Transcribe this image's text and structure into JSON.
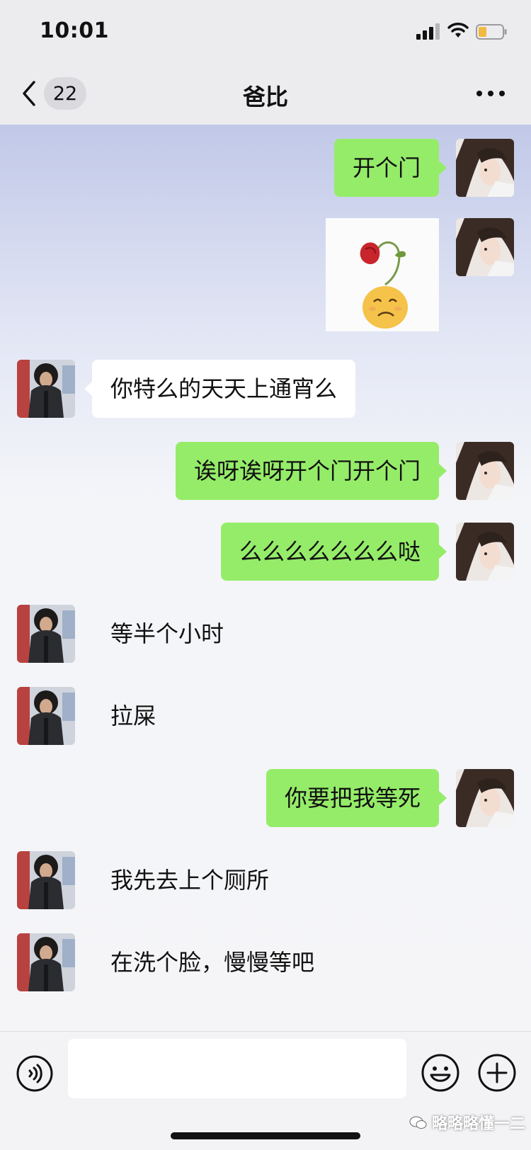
{
  "status_bar": {
    "time": "10:01"
  },
  "header": {
    "unread_count": "22",
    "title": "爸比"
  },
  "messages": [
    {
      "side": "right",
      "type": "text",
      "text": "开个门"
    },
    {
      "side": "right",
      "type": "sticker",
      "icon": "wilted-rose-sad-face-sticker"
    },
    {
      "side": "left",
      "type": "text",
      "text": "你特么的天天上通宵么"
    },
    {
      "side": "right",
      "type": "text",
      "text": "诶呀诶呀开个门开个门"
    },
    {
      "side": "right",
      "type": "text",
      "text": "么么么么么么么哒"
    },
    {
      "side": "left",
      "type": "text",
      "text": "等半个小时"
    },
    {
      "side": "left",
      "type": "text",
      "text": "拉屎"
    },
    {
      "side": "right",
      "type": "text",
      "text": "你要把我等死"
    },
    {
      "side": "left",
      "type": "text",
      "text": "我先去上个厕所"
    },
    {
      "side": "left",
      "type": "text",
      "text": "在洗个脸，慢慢等吧"
    }
  ],
  "input_bar": {
    "text_value": ""
  },
  "watermark": {
    "text": "略略略懂一二"
  },
  "colors": {
    "sent_bubble": "#95ec69",
    "received_bubble": "#ffffff",
    "chat_background_top": "#aeb7df"
  },
  "icons": [
    "back-chevron-icon",
    "more-icon",
    "voice-icon",
    "emoji-icon",
    "plus-icon",
    "wechat-logo-icon",
    "signal-icon",
    "wifi-icon",
    "battery-icon"
  ]
}
